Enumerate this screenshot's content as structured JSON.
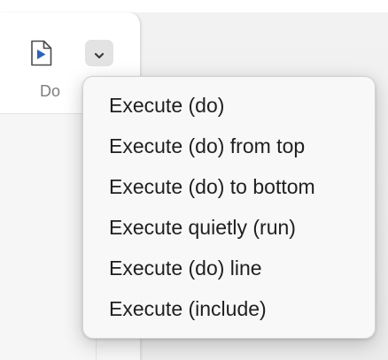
{
  "toolbar": {
    "do_label": "Do",
    "do_icon": "run-document-icon",
    "dropdown_icon": "chevron-down-icon"
  },
  "menu": {
    "items": [
      {
        "label": "Execute (do)"
      },
      {
        "label": "Execute (do) from top"
      },
      {
        "label": "Execute (do) to bottom"
      },
      {
        "label": "Execute quietly (run)"
      },
      {
        "label": "Execute (do) line"
      },
      {
        "label": "Execute (include)"
      }
    ]
  },
  "colors": {
    "icon_blue": "#2f63b8",
    "menu_text": "#1f1f1f",
    "label_gray": "#7d7d7d"
  }
}
